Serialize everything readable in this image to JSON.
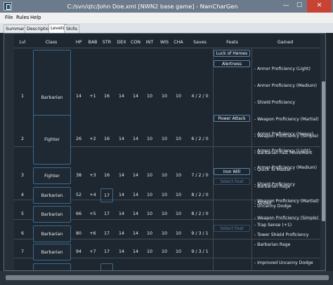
{
  "window": {
    "title": "C:/svn/qtc/John Doe.xml [NWN2 base game] - NwnCharGen",
    "minimize": "—",
    "maximize": "☐",
    "close": "✕"
  },
  "menu": [
    "File",
    "Rules",
    "Help"
  ],
  "tabs": [
    {
      "label": "Summary",
      "active": false
    },
    {
      "label": "Description",
      "active": false
    },
    {
      "label": "Levels",
      "active": true
    },
    {
      "label": "Skills",
      "active": false
    }
  ],
  "table": {
    "headers": [
      "Lvl",
      "Class",
      "HP",
      "BAB",
      "STR",
      "DEX",
      "CON",
      "INT",
      "WIS",
      "CHA",
      "Saves",
      "Feats",
      "Gained"
    ],
    "rows": [
      {
        "lvl": "1",
        "class": "Barbarian",
        "hp": "14",
        "bab": "+1",
        "str": "16",
        "dex": "14",
        "con": "14",
        "int": "10",
        "wis": "10",
        "cha": "10",
        "saves": "4 / 2 / 0",
        "feats": [
          {
            "label": "Luck of Heroes",
            "enabled": true
          },
          {
            "label": "Alertness",
            "enabled": true
          }
        ],
        "gained": [
          "- Armor Proficiency (Light)",
          "- Armor Proficiency (Medium)",
          "- Shield Proficiency",
          "- Weapon Proficiency (Martial)",
          "- Weapon Proficiency (Simple)",
          "- Barbarian Fast Movement",
          "- Quick To Master",
          "- Barbarian Rage",
          "- Skilled"
        ]
      },
      {
        "lvl": "2",
        "class": "Fighter",
        "hp": "26",
        "bab": "+2",
        "str": "16",
        "dex": "14",
        "con": "14",
        "int": "10",
        "wis": "10",
        "cha": "10",
        "saves": "6 / 2 / 0",
        "feats": [
          {
            "label": "Power Attack",
            "enabled": true
          }
        ],
        "gained": [
          "- Armor Proficiency (Heavy)",
          "- Armor Proficiency (Light)",
          "- Armor Proficiency (Medium)",
          "- Shield Proficiency",
          "- Weapon Proficiency (Martial)",
          "- Weapon Proficiency (Simple)",
          "- Tower Shield Proficiency"
        ]
      },
      {
        "lvl": "3",
        "class": "Fighter",
        "hp": "38",
        "bab": "+3",
        "str": "16",
        "dex": "14",
        "con": "14",
        "int": "10",
        "wis": "10",
        "cha": "10",
        "saves": "7 / 2 / 0",
        "feats": [
          {
            "label": "Iron Will",
            "enabled": true
          },
          {
            "label": "Select Feat",
            "enabled": false
          }
        ],
        "gained": []
      },
      {
        "lvl": "4",
        "class": "Barbarian",
        "hp": "52",
        "bab": "+4",
        "str": "17",
        "dex": "14",
        "con": "14",
        "int": "10",
        "wis": "10",
        "cha": "10",
        "saves": "8 / 2 / 0",
        "feats": [],
        "gained": [
          "- Uncanny Dodge"
        ]
      },
      {
        "lvl": "5",
        "class": "Barbarian",
        "hp": "66",
        "bab": "+5",
        "str": "17",
        "dex": "14",
        "con": "14",
        "int": "10",
        "wis": "10",
        "cha": "10",
        "saves": "8 / 2 / 0",
        "feats": [],
        "gained": [
          "- Trap Sense (+1)"
        ]
      },
      {
        "lvl": "6",
        "class": "Barbarian",
        "hp": "80",
        "bab": "+6",
        "str": "17",
        "dex": "14",
        "con": "14",
        "int": "10",
        "wis": "10",
        "cha": "10",
        "saves": "9 / 3 / 1",
        "feats": [
          {
            "label": "Select Feat",
            "enabled": false
          }
        ],
        "gained": [
          "- Barbarian Rage"
        ]
      },
      {
        "lvl": "7",
        "class": "Barbarian",
        "hp": "94",
        "bab": "+7",
        "str": "17",
        "dex": "14",
        "con": "14",
        "int": "10",
        "wis": "10",
        "cha": "10",
        "saves": "9 / 3 / 1",
        "feats": [],
        "gained": [
          "- Improved Uncanny Dodge"
        ]
      }
    ]
  }
}
